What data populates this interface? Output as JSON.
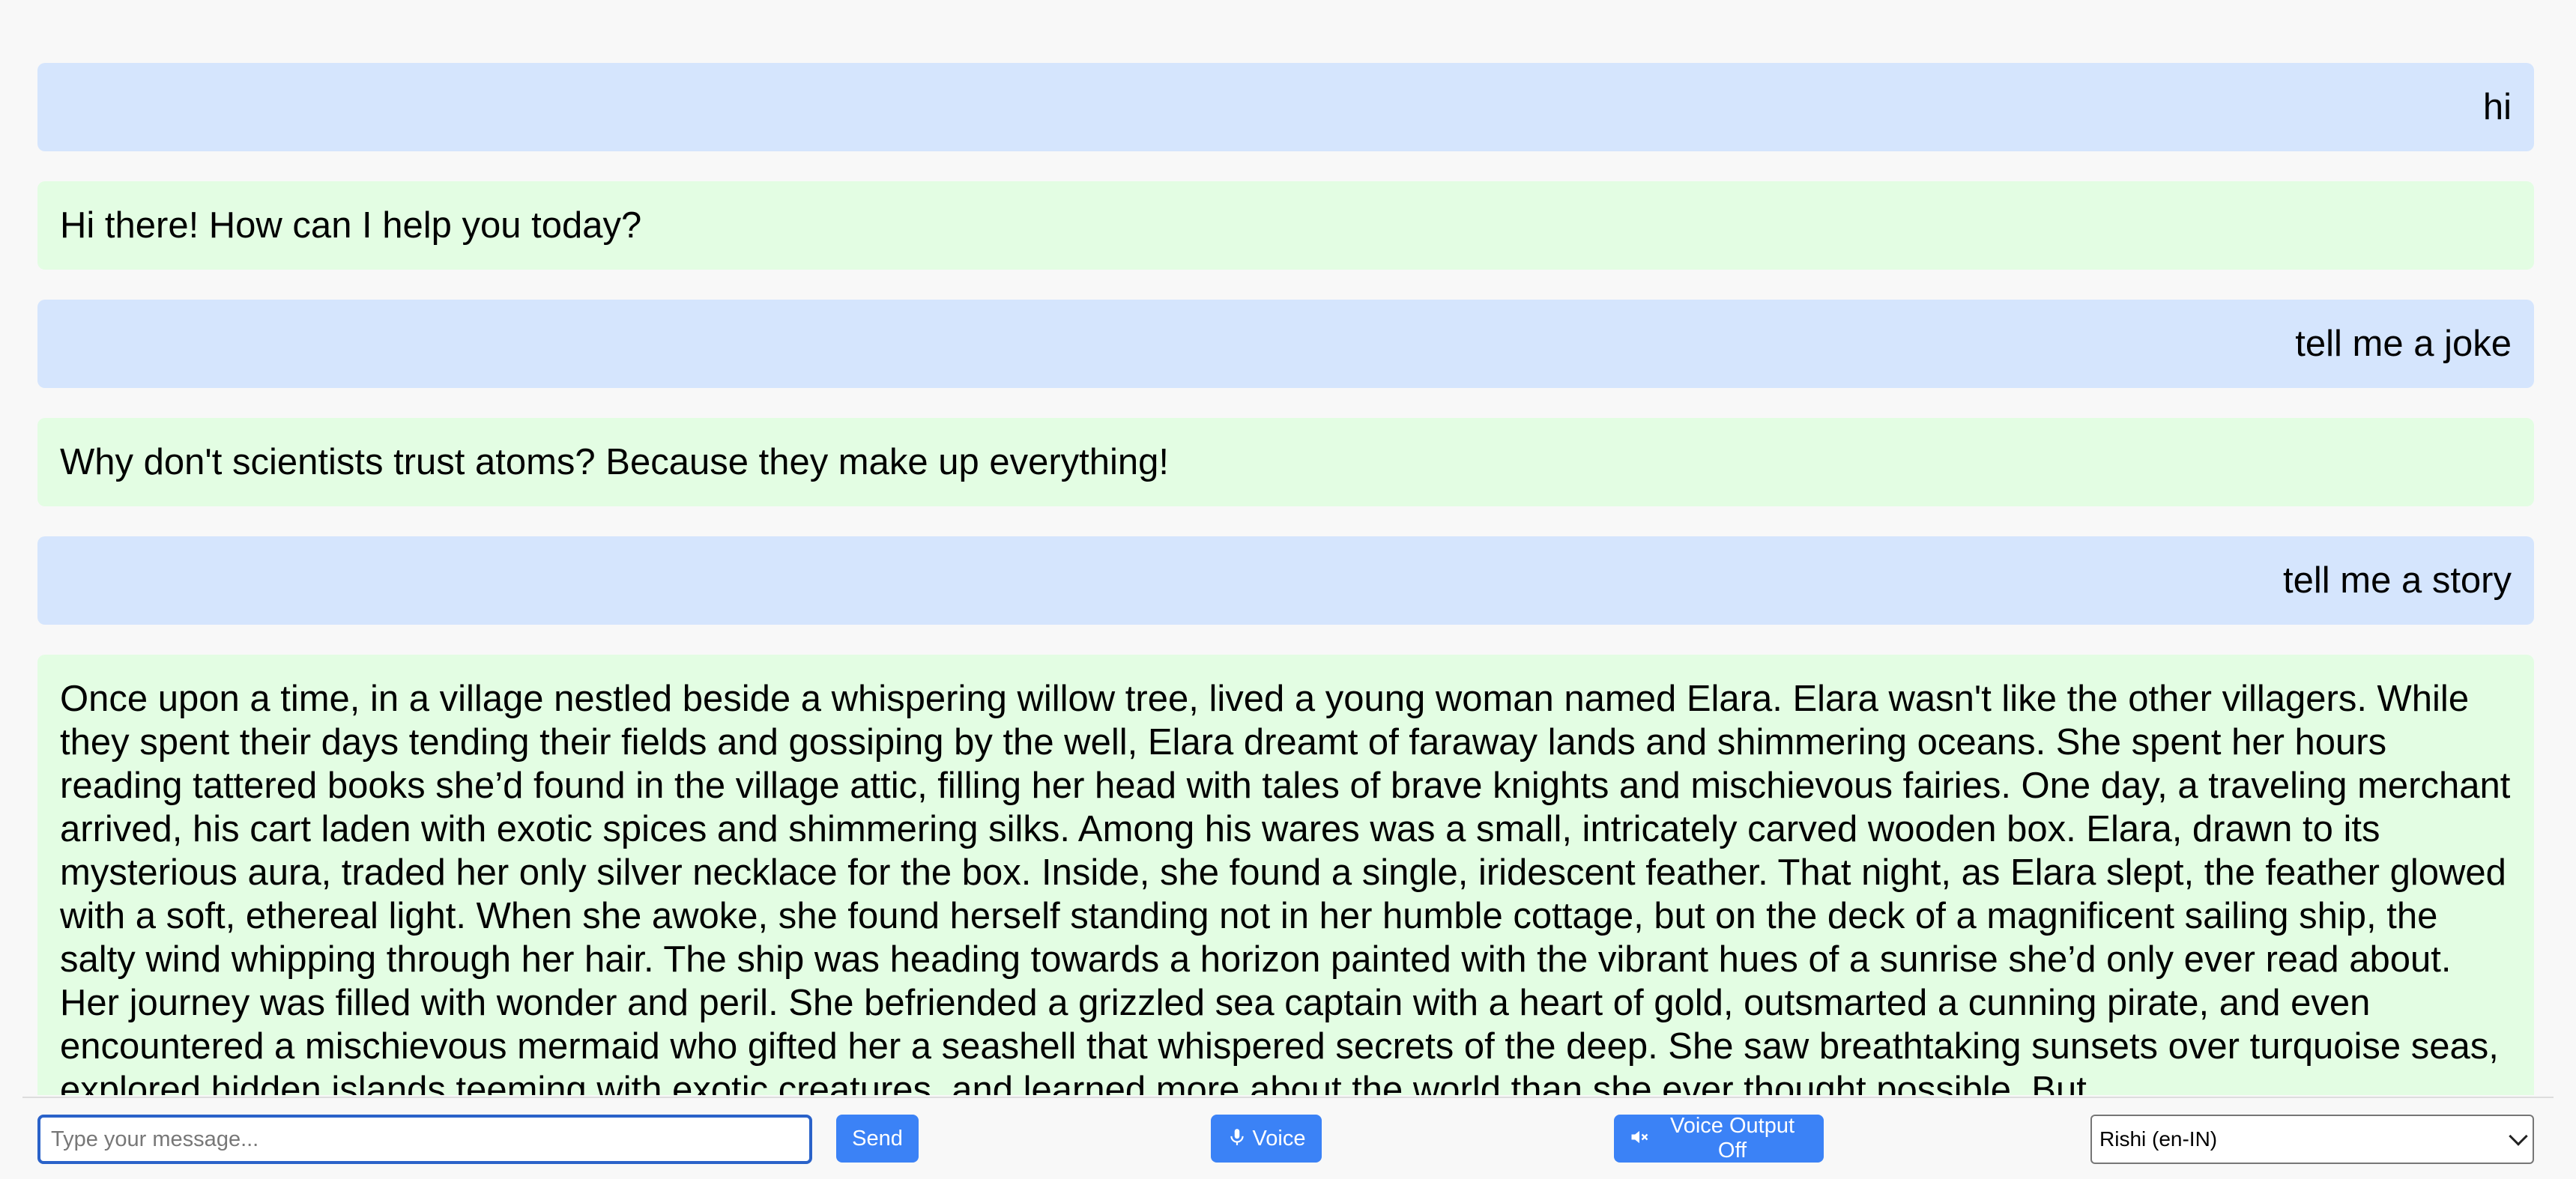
{
  "conversation": {
    "messages": [
      {
        "role": "user",
        "text": "hi"
      },
      {
        "role": "bot",
        "text": "Hi there! How can I help you today?"
      },
      {
        "role": "user",
        "text": "tell me a joke"
      },
      {
        "role": "bot",
        "text": "Why don't scientists trust atoms? Because they make up everything!"
      },
      {
        "role": "user",
        "text": "tell me a story"
      },
      {
        "role": "bot",
        "text": "Once upon a time, in a village nestled beside a whispering willow tree, lived a young woman named Elara. Elara wasn't like the other villagers. While they spent their days tending their fields and gossiping by the well, Elara dreamt of faraway lands and shimmering oceans. She spent her hours reading tattered books she’d found in the village attic, filling her head with tales of brave knights and mischievous fairies. One day, a traveling merchant arrived, his cart laden with exotic spices and shimmering silks. Among his wares was a small, intricately carved wooden box. Elara, drawn to its mysterious aura, traded her only silver necklace for the box. Inside, she found a single, iridescent feather. That night, as Elara slept, the feather glowed with a soft, ethereal light. When she awoke, she found herself standing not in her humble cottage, but on the deck of a magnificent sailing ship, the salty wind whipping through her hair. The ship was heading towards a horizon painted with the vibrant hues of a sunrise she’d only ever read about. Her journey was filled with wonder and peril. She befriended a grizzled sea captain with a heart of gold, outsmarted a cunning pirate, and even encountered a mischievous mermaid who gifted her a seashell that whispered secrets of the deep. She saw breathtaking sunsets over turquoise seas, explored hidden islands teeming with exotic creatures, and learned more about the world than she ever thought possible. But"
      }
    ]
  },
  "input": {
    "value": "",
    "placeholder": "Type your message..."
  },
  "buttons": {
    "send_label": "Send",
    "voice_label": "Voice",
    "voice_icon": "microphone-icon",
    "voice_output_label": "Voice Output Off",
    "voice_output_icon": "muted-speaker-icon"
  },
  "voice_select": {
    "selected": "Rishi (en-IN)"
  },
  "colors": {
    "user_bubble": "#d5e5fd",
    "bot_bubble": "#e3fde3",
    "button": "#3b82f6",
    "input_border": "#2a62c9"
  }
}
